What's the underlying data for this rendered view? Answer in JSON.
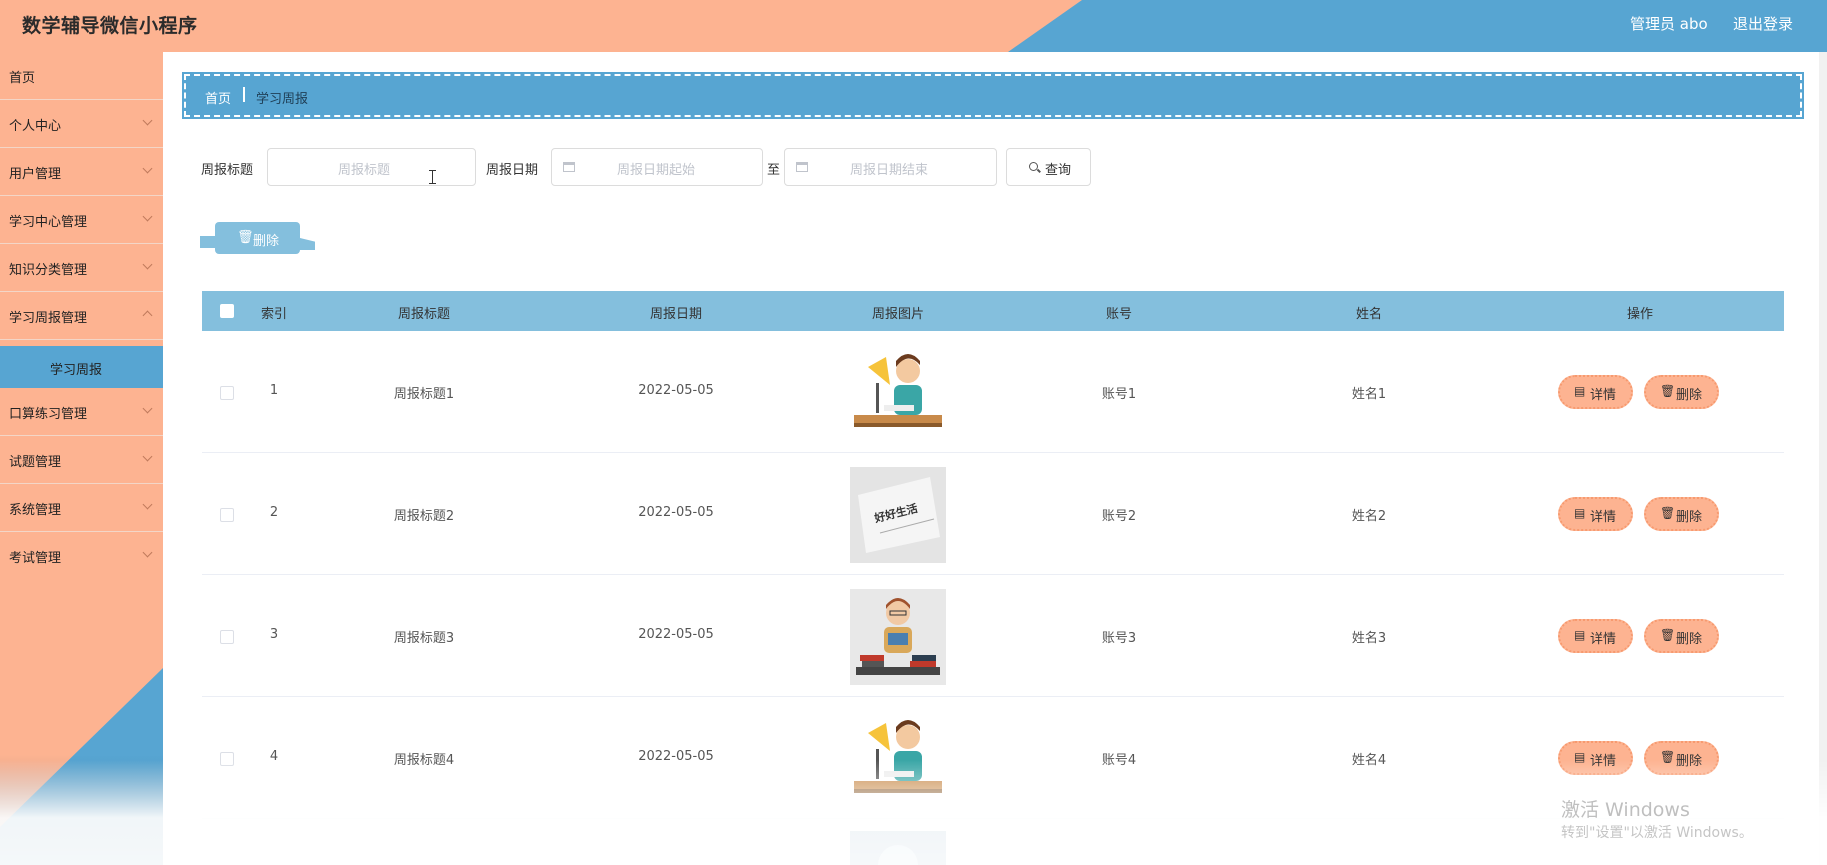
{
  "header": {
    "title": "数学辅导微信小程序",
    "admin": "管理员 abo",
    "logout": "退出登录"
  },
  "sidebar": {
    "items": [
      {
        "label": "首页"
      },
      {
        "label": "个人中心"
      },
      {
        "label": "用户管理"
      },
      {
        "label": "学习中心管理"
      },
      {
        "label": "知识分类管理"
      },
      {
        "label": "学习周报管理"
      },
      {
        "label": "学习周报"
      },
      {
        "label": "口算练习管理"
      },
      {
        "label": "试题管理"
      },
      {
        "label": "系统管理"
      },
      {
        "label": "考试管理"
      }
    ]
  },
  "breadcrumb": {
    "home": "首页",
    "current": "学习周报"
  },
  "search": {
    "title_label": "周报标题",
    "title_placeholder": "周报标题",
    "date_label": "周报日期",
    "start_placeholder": "周报日期起始",
    "to": "至",
    "end_placeholder": "周报日期结束",
    "search_button": "查询"
  },
  "actions": {
    "delete_button": "删除"
  },
  "table": {
    "columns": [
      "索引",
      "周报标题",
      "周报日期",
      "周报图片",
      "账号",
      "姓名",
      "操作"
    ],
    "rows": [
      {
        "index": "1",
        "title": "周报标题1",
        "date": "2022-05-05",
        "account": "账号1",
        "name": "姓名1",
        "image": "cartoon-student-desk"
      },
      {
        "index": "2",
        "title": "周报标题2",
        "date": "2022-05-05",
        "account": "账号2",
        "name": "姓名2",
        "image": "paper-text",
        "image_text": "好好生活"
      },
      {
        "index": "3",
        "title": "周报标题3",
        "date": "2022-05-05",
        "account": "账号3",
        "name": "姓名3",
        "image": "cartoon-reader-books"
      },
      {
        "index": "4",
        "title": "周报标题4",
        "date": "2022-05-05",
        "account": "账号4",
        "name": "姓名4",
        "image": "cartoon-student-desk"
      }
    ],
    "detail_button": "详情",
    "delete_button": "删除"
  },
  "watermark": {
    "line1": "激活 Windows",
    "line2": "转到\"设置\"以激活 Windows。"
  },
  "colors": {
    "peach": "#fdb391",
    "blue": "#57a5d2",
    "table_header": "#84bfdd"
  }
}
